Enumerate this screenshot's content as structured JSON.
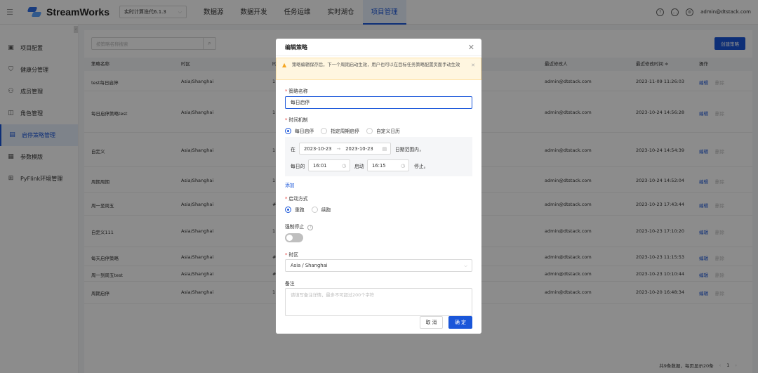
{
  "header": {
    "brand": "StreamWorks",
    "version": "实时计算迭代6.1.3",
    "nav": [
      "数据源",
      "数据开发",
      "任务运维",
      "实时湖仓",
      "项目管理"
    ],
    "active_nav": "项目管理",
    "user": "admin@dtstack.com"
  },
  "sidebar": {
    "items": [
      {
        "label": "项目配置",
        "icon": "settings-icon"
      },
      {
        "label": "健康分管理",
        "icon": "shield-icon"
      },
      {
        "label": "成员管理",
        "icon": "users-icon"
      },
      {
        "label": "角色管理",
        "icon": "role-icon"
      },
      {
        "label": "启停策略管理",
        "icon": "calendar-icon"
      },
      {
        "label": "参数模版",
        "icon": "template-icon"
      },
      {
        "label": "PyFlink环境管理",
        "icon": "python-icon"
      }
    ],
    "active": "启停策略管理"
  },
  "main": {
    "search_placeholder": "按策略名称搜索",
    "create_label": "创建策略",
    "columns": [
      "策略名称",
      "时区",
      "时",
      "最近修改人",
      "最近修改时间 ≑",
      "操作"
    ],
    "rows": [
      {
        "name": "test每日启停",
        "tz": "Asia/Shanghai",
        "mark": "1",
        "user": "admin@dtstack.com",
        "time": "2023-11-09 11:26:03"
      },
      {
        "name": "每日启停策略test",
        "tz": "Asia/Shanghai",
        "mark": "1",
        "user": "admin@dtstack.com",
        "time": "2023-10-24 14:56:28"
      },
      {
        "name": "自定义",
        "tz": "Asia/Shanghai",
        "mark": "1",
        "user": "admin@dtstack.com",
        "time": "2023-10-24 14:54:39"
      },
      {
        "name": "周期周期",
        "tz": "Asia/Shanghai",
        "mark": "1",
        "user": "admin@dtstack.com",
        "time": "2023-10-24 14:52:04"
      },
      {
        "name": "周一至周五",
        "tz": "Asia/Shanghai",
        "mark": "#",
        "user": "admin@dtstack.com",
        "time": "2023-10-23 17:43:44"
      },
      {
        "name": "自定义111",
        "tz": "Asia/Shanghai",
        "mark": "1",
        "user": "admin@dtstack.com",
        "time": "2023-10-23 17:10:20"
      },
      {
        "name": "每天启停策略",
        "tz": "Asia/Shanghai",
        "mark": "#",
        "user": "admin@dtstack.com",
        "time": "2023-10-23 11:15:53"
      },
      {
        "name": "周一到周五test",
        "tz": "Asia/Shanghai",
        "mark": "#",
        "user": "admin@dtstack.com",
        "time": "2023-10-23 10:10:44"
      },
      {
        "name": "周期启停",
        "tz": "Asia/Shanghai",
        "mark": "1",
        "user": "admin@dtstack.com",
        "time": "2023-10-20 16:48:34"
      }
    ],
    "edit_label": "编辑",
    "delete_label": "删除",
    "pager_text": "共9条数据，每页显示20条",
    "page": "1"
  },
  "modal": {
    "title": "编辑策略",
    "alert": "策略编辑保存后，下一个周期启动生效，用户也可以在目标任务策略配置页面手动生效",
    "name_label": "策略名称",
    "name_value": "每日启停",
    "time_label": "时间机制",
    "time_options": [
      "每日启停",
      "指定周期启停",
      "自定义日历"
    ],
    "in_label": "在",
    "date_start": "2023-10-23",
    "date_end": "2023-10-23",
    "date_suffix": "日期范围内，",
    "daily_label": "每日的",
    "start_time": "16:01",
    "start_label": "启动",
    "stop_time": "16:15",
    "stop_label": "停止。",
    "add_label": "添加",
    "start_mode_label": "启动方式",
    "start_modes": [
      "重跑",
      "续跑"
    ],
    "force_stop_label": "强制停止",
    "tz_label": "时区",
    "tz_value": "Asia / Shanghai",
    "remark_label": "备注",
    "remark_placeholder": "请填写备注详情，最多不可超过200个字符",
    "cancel_label": "取 消",
    "ok_label": "确 定"
  }
}
